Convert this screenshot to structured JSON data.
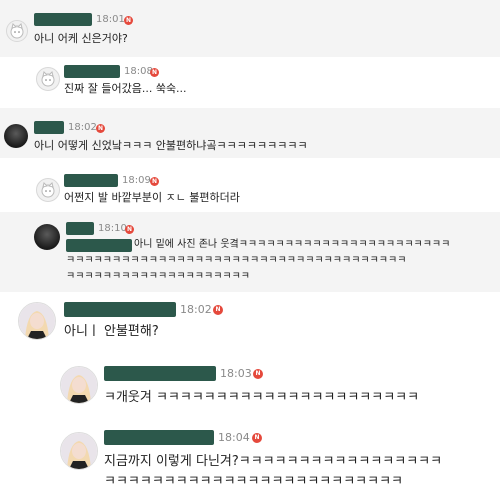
{
  "messages": [
    {
      "time": "18:01",
      "text": "아니 어케 신은거야?"
    },
    {
      "time": "18:08",
      "text": "진짜 잘 들어갔음... 쑥숙..."
    },
    {
      "time": "18:02",
      "text": "아니 어떻게 신었낰ㅋㅋㅋ 안불편하냐곸ㅋㅋㅋㅋㅋㅋㅋㅋㅋ"
    },
    {
      "time": "18:09",
      "text": "어쩐지 발 바깥부분이 ㅈㄴ 불편하더라"
    },
    {
      "time": "18:10",
      "line1": "아니 밑에 사진 존나 웃곀ㅋㅋㅋㅋㅋㅋㅋㅋㅋㅋㅋㅋㅋㅋㅋㅋㅋㅋㅋㅋㅋㅋㅋ",
      "line2": "ㅋㅋㅋㅋㅋㅋㅋㅋㅋㅋㅋㅋㅋㅋㅋㅋㅋㅋㅋㅋㅋㅋㅋㅋㅋㅋㅋㅋㅋㅋㅋㅋㅋㅋㅋㅋㅋ",
      "line3": "ㅋㅋㅋㅋㅋㅋㅋㅋㅋㅋㅋㅋㅋㅋㅋㅋㅋㅋㅋㅋ"
    },
    {
      "time": "18:02",
      "text": "아니ㅣ 안불편해?"
    },
    {
      "time": "18:03",
      "text": "ㅋ개웃겨 ㅋㅋㅋㅋㅋㅋㅋㅋㅋㅋㅋㅋㅋㅋㅋㅋㅋㅋㅋㅋㅋㅋ"
    },
    {
      "time": "18:04",
      "line1": "지금까지 이렇게 다닌겨?ㅋㅋㅋㅋㅋㅋㅋㅋㅋㅋㅋㅋㅋㅋㅋㅋㅋ",
      "line2": "ㅋㅋㅋㅋㅋㅋㅋㅋㅋㅋㅋㅋㅋㅋㅋㅋㅋㅋㅋㅋㅋㅋㅋㅋㅋ"
    }
  ],
  "badge_label": "N",
  "colors": {
    "redaction": "#1a4a3c",
    "badge": "#e5493c",
    "timestamp": "#8a8a8a"
  },
  "avatars": [
    "cat-icon",
    "dark-profile",
    "cat-icon",
    "cat-icon",
    "dark-profile",
    "girl-profile",
    "girl-profile",
    "girl-profile"
  ]
}
